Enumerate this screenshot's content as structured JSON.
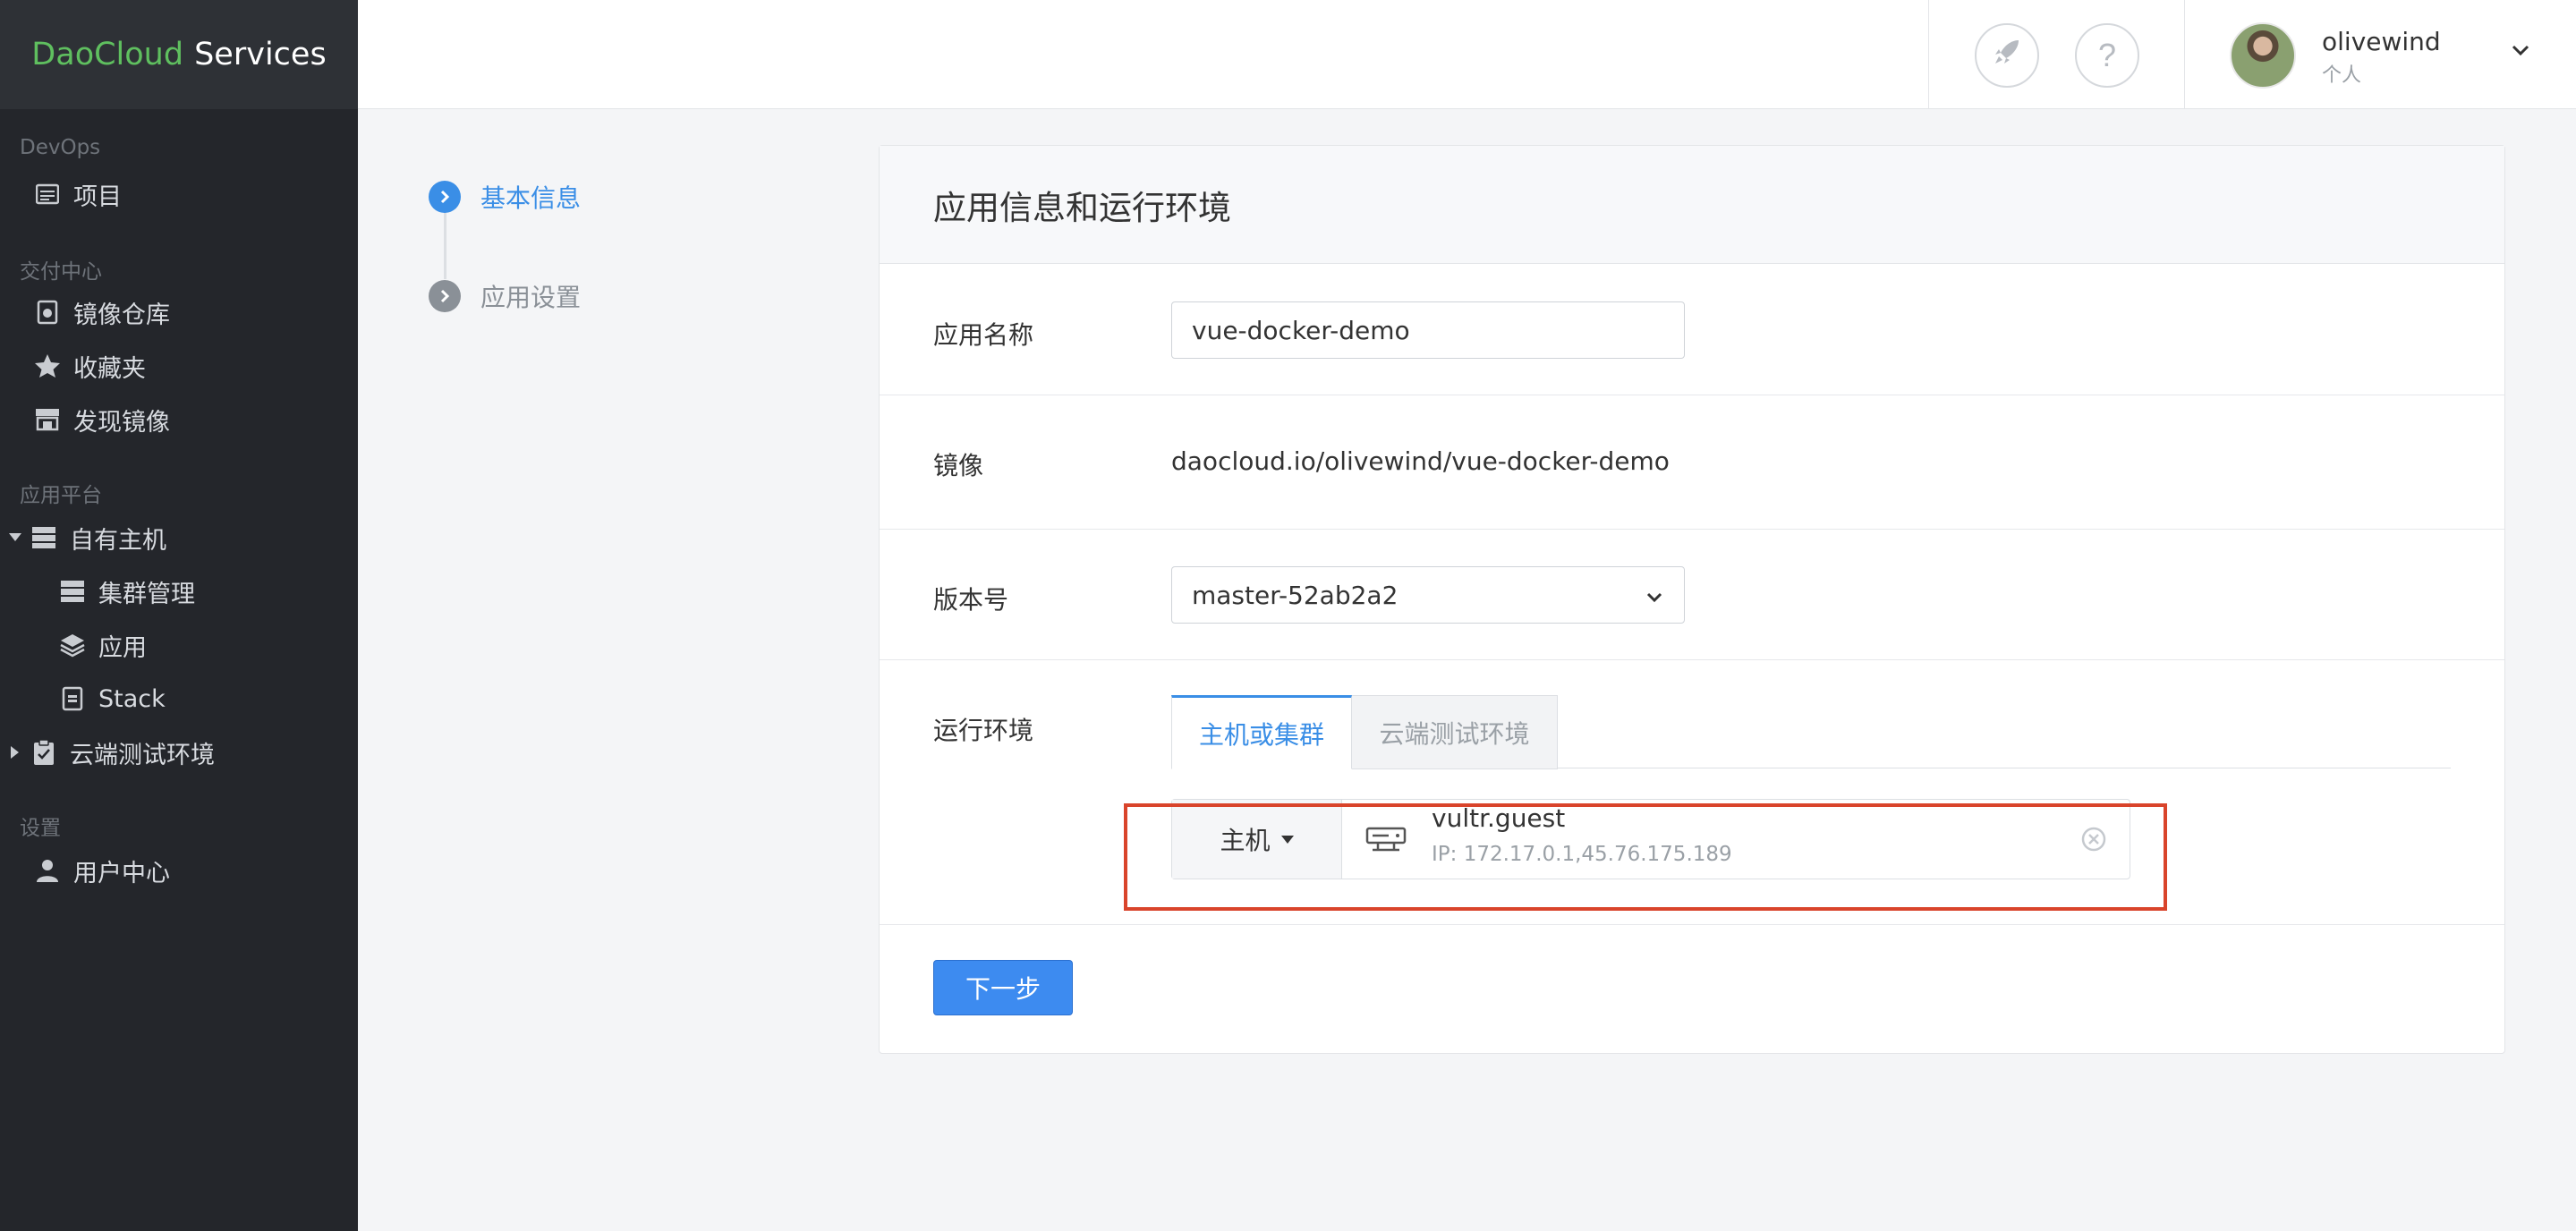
{
  "brand": {
    "name_green": "DaoCloud",
    "name_white": "Services",
    "green": "#5fbf5f"
  },
  "sidebar": {
    "sections": [
      {
        "title": "DevOps",
        "items": [
          {
            "label": "项目",
            "icon": "calendar-list-icon"
          }
        ]
      },
      {
        "title": "交付中心",
        "items": [
          {
            "label": "镜像仓库",
            "icon": "package-icon"
          },
          {
            "label": "收藏夹",
            "icon": "star-icon"
          },
          {
            "label": "发现镜像",
            "icon": "store-icon"
          }
        ]
      },
      {
        "title": "应用平台",
        "items": [
          {
            "label": "自有主机",
            "icon": "server-stack-icon",
            "expanded": true
          },
          {
            "label": "集群管理",
            "icon": "server-stack-icon",
            "sub": true
          },
          {
            "label": "应用",
            "icon": "layers-icon",
            "sub": true
          },
          {
            "label": "Stack",
            "icon": "stack-file-icon",
            "sub": true
          },
          {
            "label": "云端测试环境",
            "icon": "clipboard-icon",
            "expanded": false
          }
        ]
      },
      {
        "title": "设置",
        "items": [
          {
            "label": "用户中心",
            "icon": "user-icon"
          }
        ]
      }
    ]
  },
  "topbar": {
    "help_label": "?",
    "user": {
      "name": "olivewind",
      "type": "个人"
    }
  },
  "steps": [
    {
      "label": "基本信息",
      "active": true
    },
    {
      "label": "应用设置",
      "active": false
    }
  ],
  "form": {
    "title": "应用信息和运行环境",
    "app_name": {
      "label": "应用名称",
      "value": "vue-docker-demo"
    },
    "image": {
      "label": "镜像",
      "value": "daocloud.io/olivewind/vue-docker-demo"
    },
    "version": {
      "label": "版本号",
      "value": "master-52ab2a2"
    },
    "runtime": {
      "label": "运行环境",
      "tabs": [
        {
          "label": "主机或集群",
          "active": true
        },
        {
          "label": "云端测试环境",
          "active": false
        }
      ],
      "host_type": "主机",
      "host_name": "vultr.guest",
      "host_ip": "IP: 172.17.0.1,45.76.175.189"
    },
    "next_button": "下一步"
  },
  "colors": {
    "accent": "#3a8ee6",
    "highlight": "#d9442b",
    "sidebar_bg": "#24262b"
  }
}
